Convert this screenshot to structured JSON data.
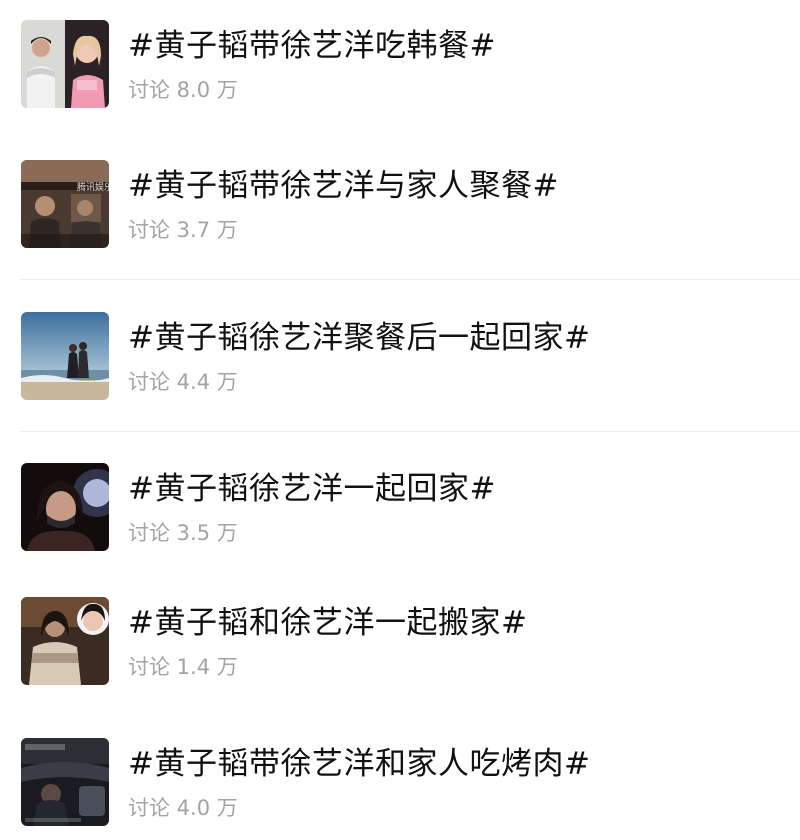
{
  "topics": [
    {
      "title": "#黄子韬带徐艺洋吃韩餐#",
      "meta": "讨论 8.0 万",
      "thumb_icon": "couple-photo"
    },
    {
      "title": "#黄子韬带徐艺洋与家人聚餐#",
      "meta": "讨论 3.7 万",
      "thumb_icon": "restaurant-photo",
      "watermark": "腾讯娱乐"
    },
    {
      "title": "#黄子韬徐艺洋聚餐后一起回家#",
      "meta": "讨论 4.4 万",
      "thumb_icon": "beach-couple-photo"
    },
    {
      "title": "#黄子韬徐艺洋一起回家#",
      "meta": "讨论 3.5 万",
      "thumb_icon": "masked-woman-photo"
    },
    {
      "title": "#黄子韬和徐艺洋一起搬家#",
      "meta": "讨论 1.4 万",
      "thumb_icon": "moving-photo"
    },
    {
      "title": "#黄子韬带徐艺洋和家人吃烤肉#",
      "meta": "讨论 4.0 万",
      "thumb_icon": "car-night-photo"
    }
  ],
  "colors": {
    "title": "#111111",
    "meta": "#a3a3a3",
    "divider": "#ececec",
    "background": "#ffffff"
  }
}
